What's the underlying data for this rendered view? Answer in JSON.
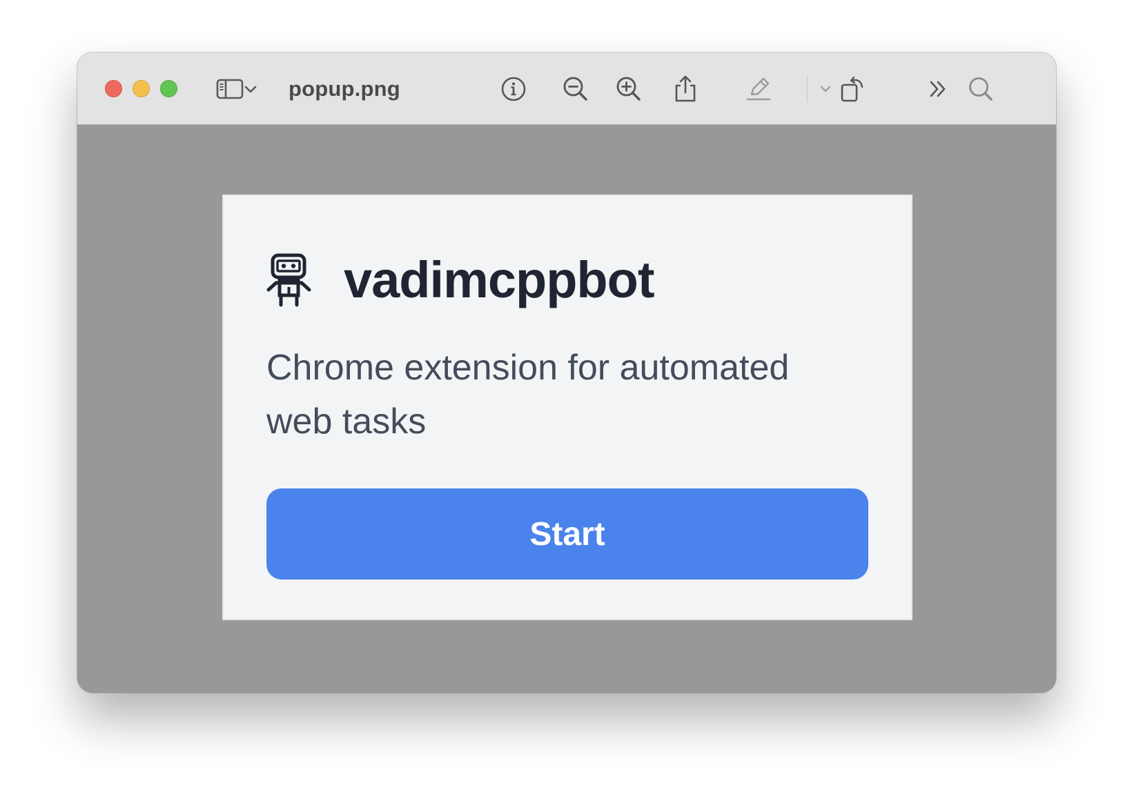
{
  "window": {
    "title": "popup.png",
    "traffic_lights": [
      "close",
      "minimize",
      "zoom"
    ]
  },
  "toolbar": {
    "icons": [
      "sidebar-icon",
      "chevron-down-icon",
      "info-icon",
      "zoom-out-icon",
      "zoom-in-icon",
      "share-icon",
      "markup-pencil-icon",
      "chevron-down-icon",
      "rotate-icon",
      "more-icon",
      "search-icon"
    ]
  },
  "popup": {
    "logo_icon": "robot-icon",
    "app_name": "vadimcppbot",
    "tagline": "Chrome extension for automated web tasks",
    "start_label": "Start"
  },
  "colors": {
    "titlebar": "#e3e3e3",
    "canvas": "#989898",
    "popup_bg": "#f3f4f6",
    "primary_button": "#4a83ec",
    "heading_text": "#1f2532",
    "body_text": "#444c5a"
  }
}
